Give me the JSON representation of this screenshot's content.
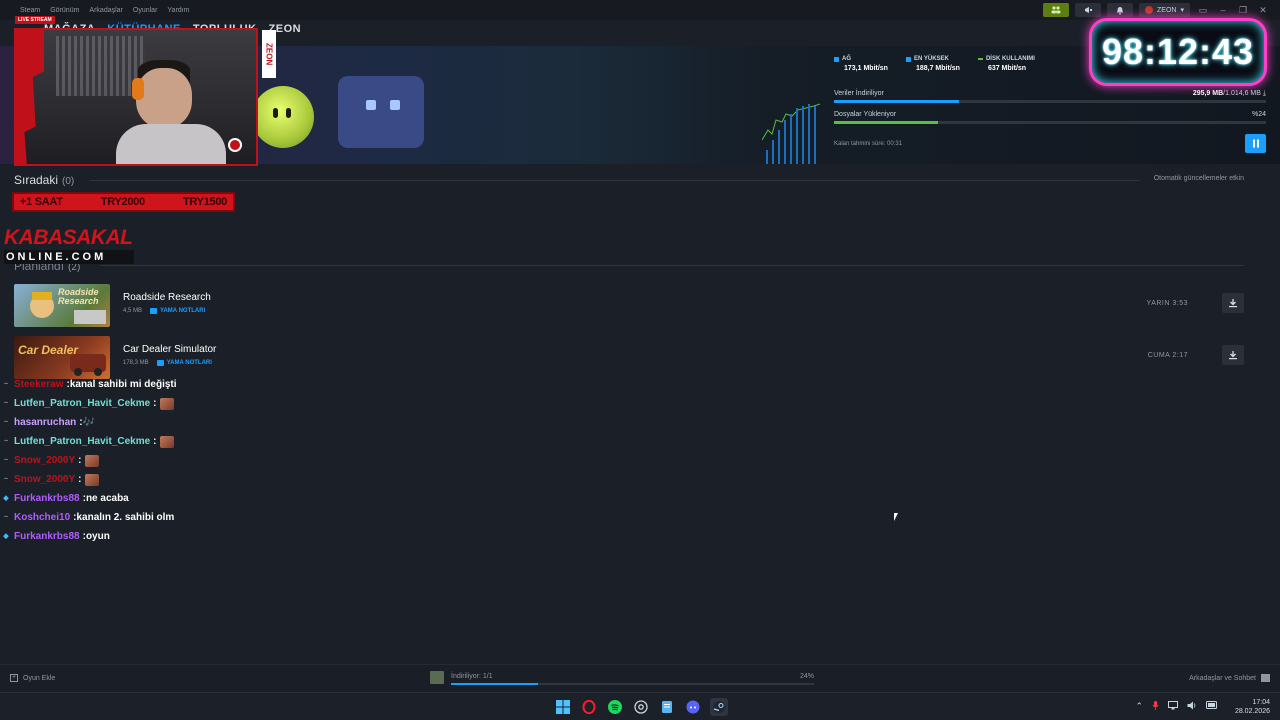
{
  "menu": {
    "items": [
      "Steam",
      "Görünüm",
      "Arkadaşlar",
      "Oyunlar",
      "Yardım"
    ]
  },
  "titlebar": {
    "username": "ZEON",
    "window_controls": [
      "–",
      "❐",
      "✕"
    ]
  },
  "nav": {
    "tabs": [
      {
        "label": "MAĞAZA",
        "active": false
      },
      {
        "label": "KÜTÜPHANE",
        "active": true
      },
      {
        "label": "TOPLULUK",
        "active": false
      },
      {
        "label": "ZEON",
        "active": false
      }
    ]
  },
  "overlay": {
    "live_badge": "LIVE STREAM",
    "side_tag": "ZEON",
    "timer": "98:12:43",
    "price_banner": [
      "+1 SAAT",
      "TRY2000",
      "TRY1500"
    ],
    "brand_top": "KABASAKAL",
    "brand_bottom": "ONLINE.COM"
  },
  "download": {
    "stats": [
      {
        "label": "AĞ",
        "value": "173,1 Mbit/sn",
        "color": "#1a9fff"
      },
      {
        "label": "EN YÜKSEK",
        "value": "188,7 Mbit/sn",
        "color": "#1a9fff"
      },
      {
        "label": "DİSK KULLANIMI",
        "value": "637 Mbit/sn",
        "color": "#59bf40"
      }
    ],
    "downloading_label": "Veriler İndiriliyor",
    "downloaded": "295,9 MB",
    "total": "1.014,6 MB",
    "download_progress": 0.29,
    "installing_label": "Dosyalar Yükleniyor",
    "install_percent_label": "%24",
    "install_progress": 0.24,
    "eta": "Kalan tahmini süre: 00:31"
  },
  "queue": {
    "title": "Sıradaki",
    "count": "(0)",
    "auto_updates": "Otomatik güncellemeler etkin"
  },
  "scheduled": {
    "title": "Planlandı",
    "count": "(2)",
    "games": [
      {
        "name": "Roadside Research",
        "size": "4,5 MB",
        "patch_notes": "YAMA NOTLARI",
        "when": "YARIN 3:53",
        "thumb_text": "Roadside Research",
        "thumb_color": "#5a7a3a"
      },
      {
        "name": "Car Dealer Simulator",
        "size": "178,3 MB",
        "patch_notes": "YAMA NOTLARI",
        "when": "CUMA 2:17",
        "thumb_text": "Car Dealer",
        "thumb_color": "#6a2a1a"
      }
    ]
  },
  "chat": [
    {
      "user": "Steekeraw",
      "color": "#c0111a",
      "badge": "~",
      "message": "kanal sahibi mi değişti",
      "emote": false
    },
    {
      "user": "Lutfen_Patron_Havit_Cekme",
      "color": "#6fe0d6",
      "badge": "~",
      "message": "",
      "emote": true
    },
    {
      "user": "hasanruchan",
      "color": "#c9a0ff",
      "badge": "~",
      "message": "🎶",
      "emote": false
    },
    {
      "user": "Lutfen_Patron_Havit_Cekme",
      "color": "#6fe0d6",
      "badge": "~",
      "message": "",
      "emote": true
    },
    {
      "user": "Snow_2000Y",
      "color": "#c0111a",
      "badge": "~",
      "message": "",
      "emote": true
    },
    {
      "user": "Snow_2000Y",
      "color": "#c0111a",
      "badge": "~",
      "message": "",
      "emote": true
    },
    {
      "user": "Furkankrbs88",
      "color": "#b05cff",
      "badge": "◆",
      "message": "ne acaba",
      "emote": false
    },
    {
      "user": "Koshchei10",
      "color": "#b05cff",
      "badge": "~",
      "message": "kanalın 2. sahibi olm",
      "emote": false
    },
    {
      "user": "Furkankrbs88",
      "color": "#b05cff",
      "badge": "◆",
      "message": "oyun",
      "emote": false
    }
  ],
  "bottombar": {
    "add_game": "Oyun Ekle",
    "downloading": "İndiriliyor: 1/1",
    "percent": "24%",
    "progress": 0.24,
    "friends_chat": "Arkadaşlar ve Sohbet"
  },
  "taskbar": {
    "time": "17:04",
    "date": "28.02.2026"
  }
}
